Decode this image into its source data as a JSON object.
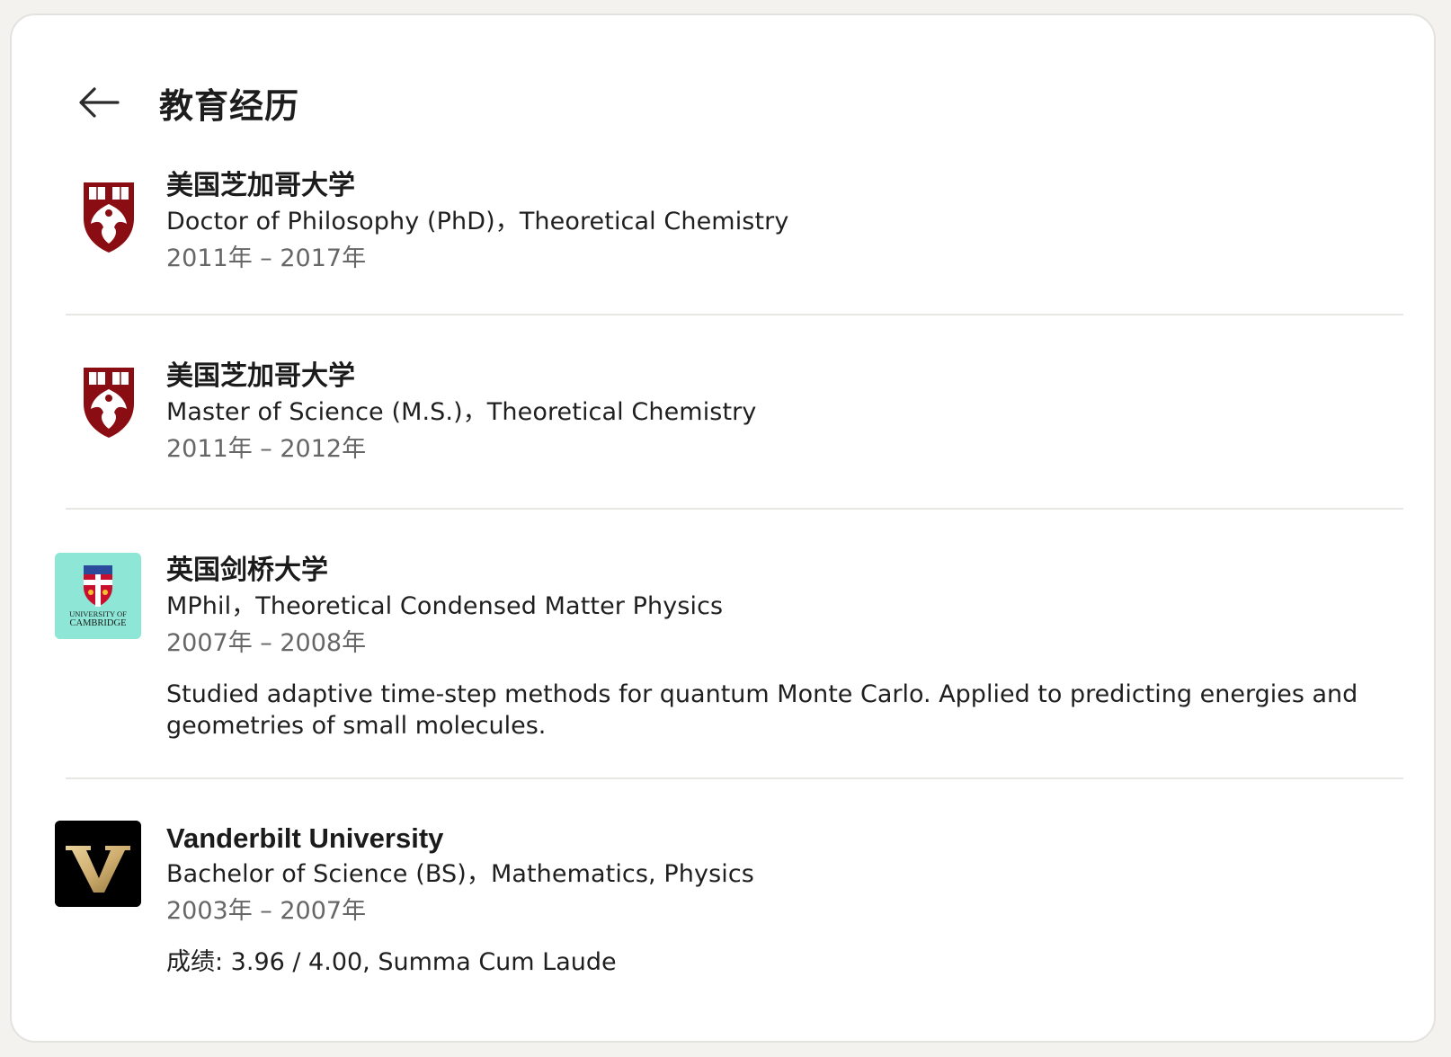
{
  "header": {
    "title": "教育经历",
    "back_icon": "arrow-left-icon"
  },
  "education": [
    {
      "school": "美国芝加哥大学",
      "degree": "Doctor of Philosophy (PhD)，Theoretical Chemistry",
      "dates": "2011年 – 2017年",
      "logo": "uchicago-crest-icon",
      "logo_colors": {
        "primary": "#8b0d14",
        "accent": "#ffffff"
      }
    },
    {
      "school": "美国芝加哥大学",
      "degree": "Master of Science (M.S.)，Theoretical Chemistry",
      "dates": "2011年 – 2012年",
      "logo": "uchicago-crest-icon",
      "logo_colors": {
        "primary": "#8b0d14",
        "accent": "#ffffff"
      }
    },
    {
      "school": "英国剑桥大学",
      "degree": "MPhil，Theoretical Condensed Matter Physics",
      "dates": "2007年 – 2008年",
      "description": "Studied adaptive time-step methods for quantum Monte Carlo.  Applied to predicting energies and geometries of small molecules.",
      "logo": "cambridge-crest-icon",
      "logo_text": "UNIVERSITY OF CAMBRIDGE",
      "logo_colors": {
        "background": "#8ee6d6",
        "primary": "#c8102e"
      }
    },
    {
      "school": "Vanderbilt University",
      "degree": "Bachelor of Science (BS)，Mathematics, Physics",
      "dates": "2003年 – 2007年",
      "description": "成绩: 3.96 / 4.00, Summa Cum Laude",
      "logo": "vanderbilt-v-icon",
      "logo_colors": {
        "background": "#000000",
        "primary": "#cfae70"
      }
    }
  ]
}
